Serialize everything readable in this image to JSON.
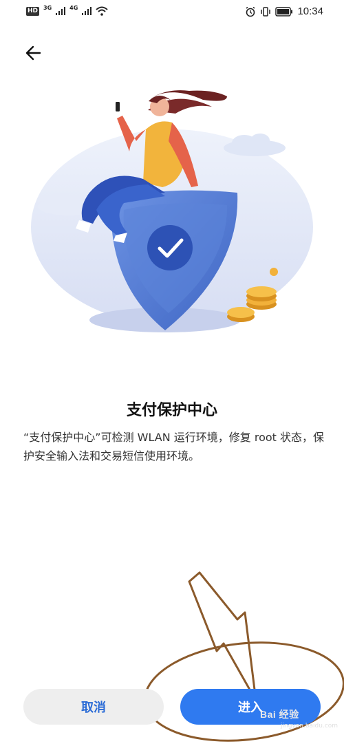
{
  "status_bar": {
    "hd_badge": "HD",
    "net1": "3G",
    "net2": "4G",
    "time": "10:34"
  },
  "header": {
    "back_icon": "arrow-left-icon"
  },
  "main": {
    "title": "支付保护中心",
    "description": "“支付保护中心”可检测 WLAN 运行环境，修复 root 状态，保护安全输入法和交易短信使用环境。"
  },
  "buttons": {
    "cancel": "取消",
    "enter": "进入"
  },
  "watermark": {
    "text": "Bai 经验",
    "sub": "jingyan.baidu.com"
  },
  "colors": {
    "accent": "#2f7af0",
    "shield": "#5b84d9",
    "annotation": "#8b5a2b"
  }
}
